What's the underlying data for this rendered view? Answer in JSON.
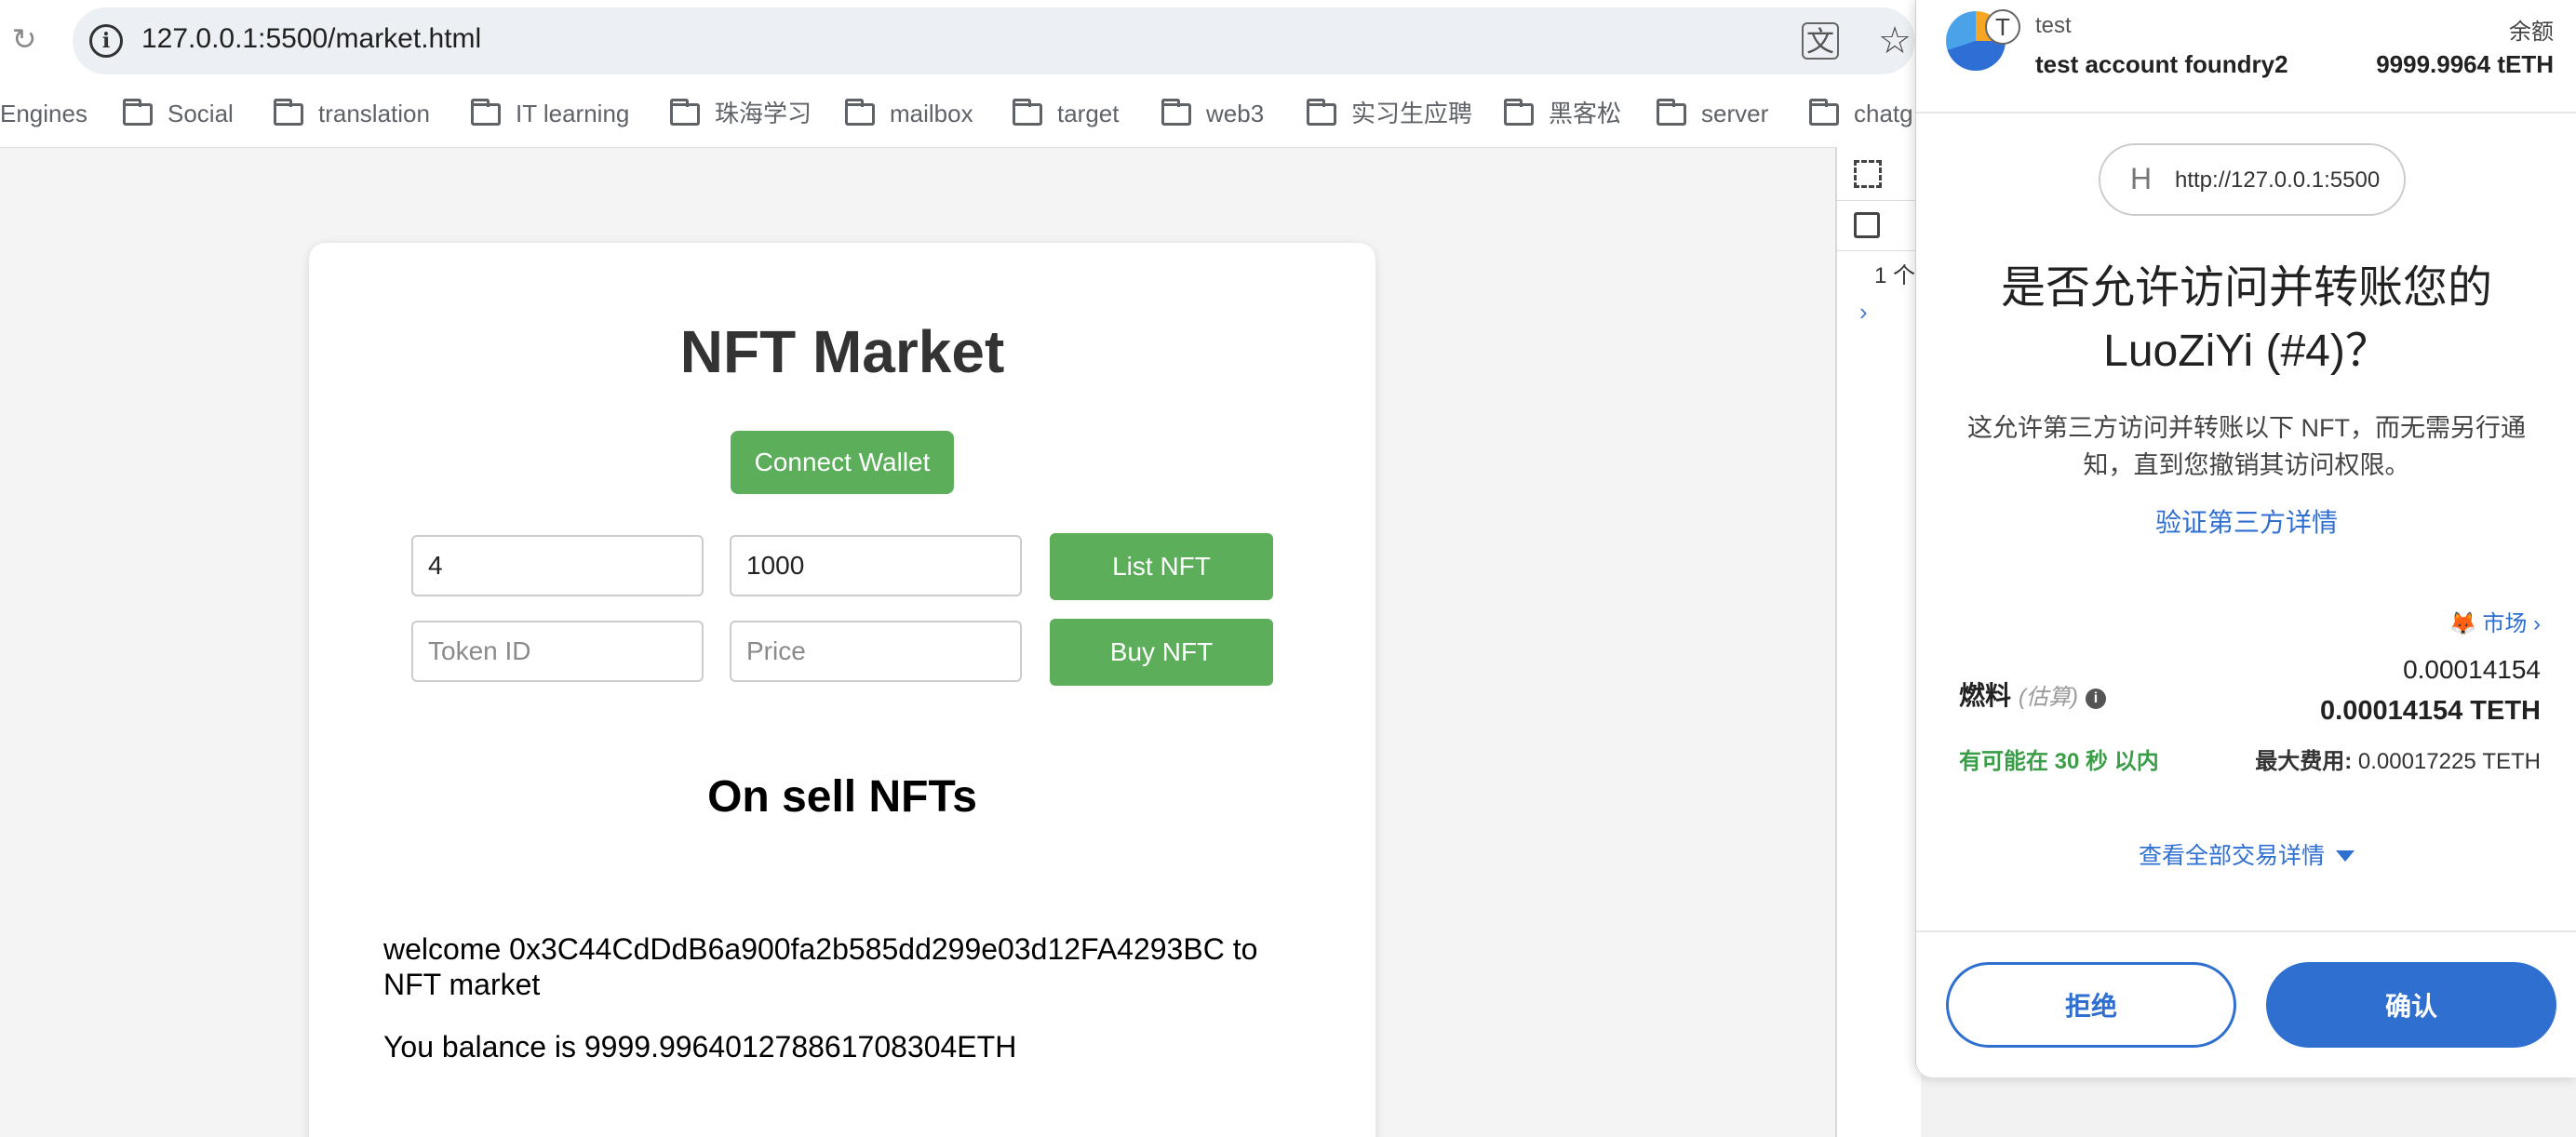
{
  "browser": {
    "url": "127.0.0.1:5500/market.html",
    "bookmarks": [
      "Engines",
      "Social",
      "translation",
      "IT learning",
      "珠海学习",
      "mailbox",
      "target",
      "web3",
      "实习生应聘",
      "黑客松",
      "server",
      "chatg"
    ]
  },
  "page": {
    "title": "NFT Market",
    "connect_label": "Connect Wallet",
    "list_form": {
      "token_value": "4",
      "price_value": "1000",
      "button": "List NFT"
    },
    "buy_form": {
      "token_placeholder": "Token ID",
      "price_placeholder": "Price",
      "button": "Buy NFT"
    },
    "onsell_title": "On sell NFTs",
    "welcome": "welcome 0x3C44CdDdB6a900fa2b585dd299e03d12FA4293BC to NFT market",
    "balance": "You balance is 9999.996401278861708304ETH"
  },
  "devtools": {
    "count_text": "1 个"
  },
  "metamask": {
    "account_short": "test",
    "account_name": "test account foundry2",
    "avatar_badge": "T",
    "balance_label": "余额",
    "balance_value": "9999.9964 tETH",
    "origin_initial": "H",
    "origin_url": "http://127.0.0.1:5500",
    "title": "是否允许访问并转账您的 LuoZiYi (#4)？",
    "description": "这允许第三方访问并转账以下 NFT，而无需另行通知，直到您撤销其访问权限。",
    "verify_link": "验证第三方详情",
    "market_link": "市场",
    "gas_label": "燃料",
    "gas_estimate": "(估算)",
    "gas_eth": "0.00014154",
    "gas_teth": "0.00014154 TETH",
    "time_hint": "有可能在 30 秒 以内",
    "max_fee_label": "最大费用:",
    "max_fee_value": "0.00017225 TETH",
    "details_link": "查看全部交易详情",
    "reject_label": "拒绝",
    "confirm_label": "确认"
  },
  "colors": {
    "green_button": "#5cae5a",
    "metamask_blue": "#2f6fd0",
    "success_green": "#3a9d48"
  }
}
